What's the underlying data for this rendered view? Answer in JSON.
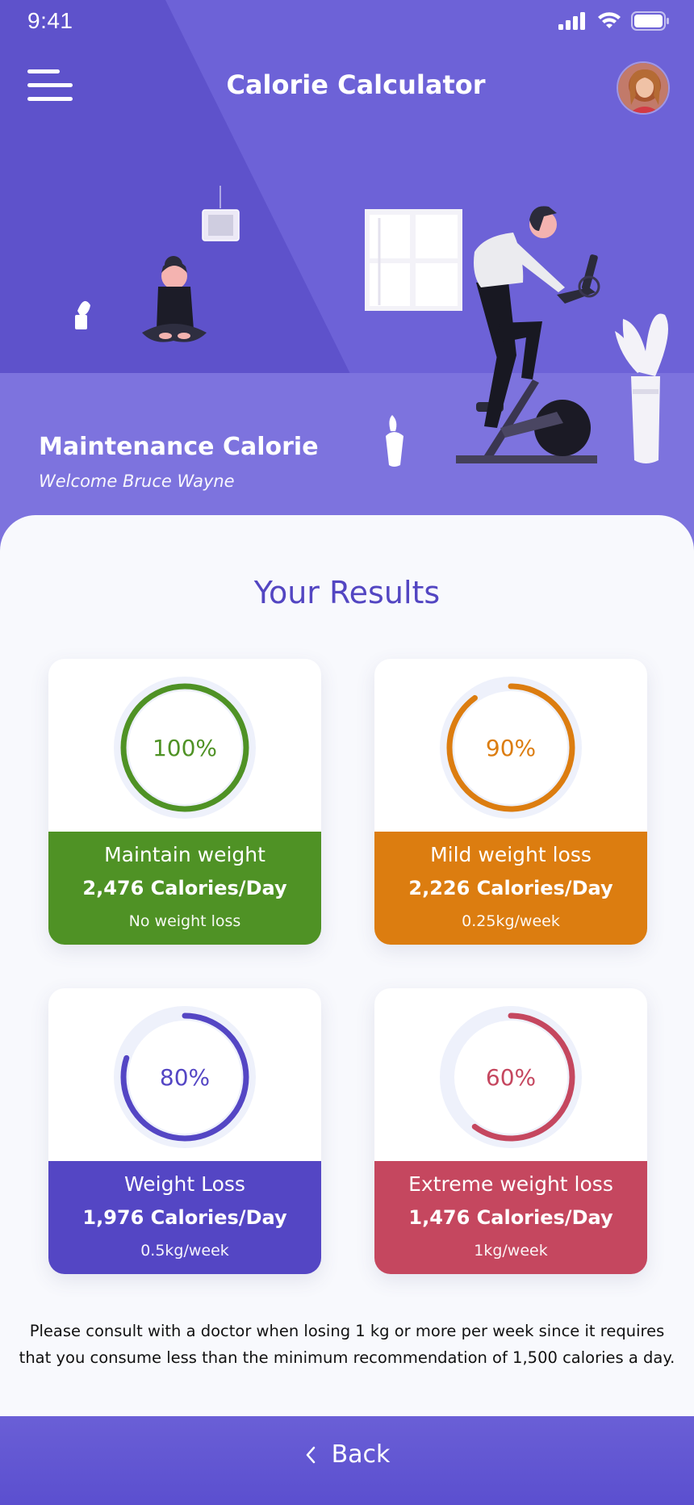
{
  "status_bar": {
    "time": "9:41",
    "signal_icon": "signal-icon",
    "wifi_icon": "wifi-icon",
    "battery_icon": "battery-icon"
  },
  "header": {
    "title": "Calorie Calculator",
    "menu_icon": "hamburger-menu-icon",
    "avatar": "user-avatar"
  },
  "hero": {
    "title": "Maintenance Calorie",
    "subtitle": "Welcome Bruce Wayne"
  },
  "colors": {
    "brand": "#5346c2",
    "hero": "#7d73de",
    "green": "#4f9225",
    "orange": "#dc7d10",
    "purple": "#5446c4",
    "red": "#c5475f"
  },
  "results": {
    "title": "Your Results",
    "cards": [
      {
        "percent": "100%",
        "level": 1.0,
        "label": "Maintain weight",
        "calories": "2,476 Calories/Day",
        "note": "No weight loss",
        "color": "#4f9225"
      },
      {
        "percent": "90%",
        "level": 0.9,
        "label": "Mild weight loss",
        "calories": "2,226 Calories/Day",
        "note": "0.25kg/week",
        "color": "#dc7d10"
      },
      {
        "percent": "80%",
        "level": 0.8,
        "label": "Weight Loss",
        "calories": "1,976 Calories/Day",
        "note": "0.5kg/week",
        "color": "#5446c4"
      },
      {
        "percent": "60%",
        "level": 0.6,
        "label": "Extreme weight loss",
        "calories": "1,476 Calories/Day",
        "note": "1kg/week",
        "color": "#c5475f"
      }
    ]
  },
  "disclaimer": "Please consult with a doctor when losing 1 kg or more per week since it requires that you consume less than the minimum recommendation of 1,500 calories a day.",
  "footer": {
    "back_label": "Back",
    "back_icon": "chevron-left-icon"
  }
}
